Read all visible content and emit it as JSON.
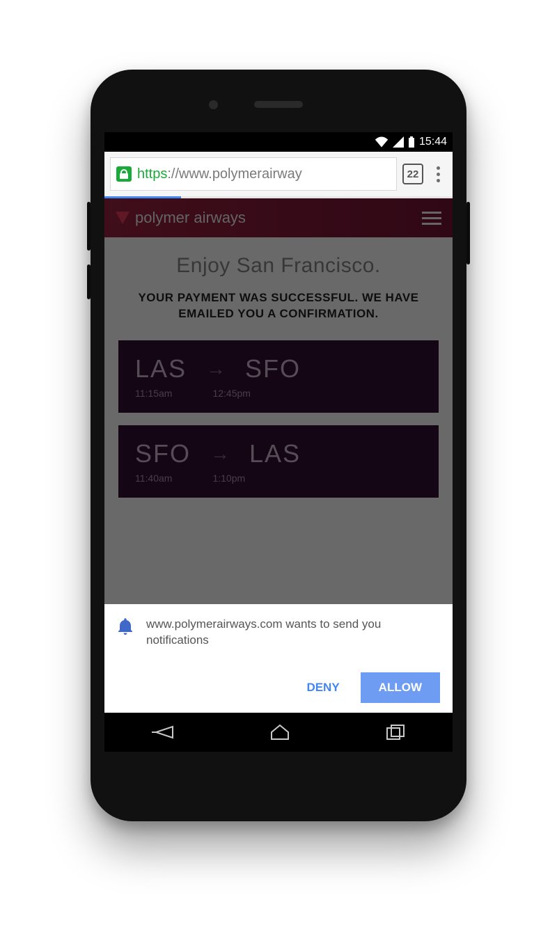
{
  "status": {
    "time": "15:44"
  },
  "browser": {
    "url_scheme": "https",
    "url_rest": "://www.polymerairway",
    "tab_count": "22"
  },
  "app": {
    "brand": "polymer airways",
    "hero": "Enjoy San Francisco.",
    "confirm": "YOUR PAYMENT WAS SUCCESSFUL. WE HAVE EMAILED YOU A CONFIRMATION.",
    "flights": [
      {
        "from": "LAS",
        "to": "SFO",
        "dep": "11:15am",
        "arr": "12:45pm"
      },
      {
        "from": "SFO",
        "to": "LAS",
        "dep": "11:40am",
        "arr": "1:10pm"
      }
    ]
  },
  "permission": {
    "text": "www.polymerairways.com wants to send you notifications",
    "deny": "DENY",
    "allow": "ALLOW"
  }
}
